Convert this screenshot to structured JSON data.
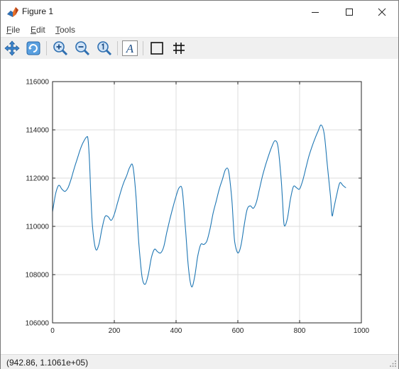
{
  "window": {
    "title": "Figure 1",
    "icon": "matlab-figure-icon",
    "controls": [
      "minimize-icon",
      "maximize-icon",
      "close-icon"
    ]
  },
  "menu": {
    "items": [
      {
        "label": "File",
        "mnemonic": "F",
        "rest": "ile"
      },
      {
        "label": "Edit",
        "mnemonic": "E",
        "rest": "dit"
      },
      {
        "label": "Tools",
        "mnemonic": "T",
        "rest": "ools"
      }
    ]
  },
  "toolbar": {
    "buttons": [
      "pan-icon",
      "rotate-icon",
      "zoom-in-icon",
      "zoom-out-icon",
      "zoom-reset-icon",
      "text-insert-icon",
      "axes-box-icon",
      "grid-icon"
    ]
  },
  "status": {
    "coordinates": "(942.86, 1.1061e+05)"
  },
  "chart_data": {
    "type": "line",
    "title": "",
    "xlabel": "",
    "ylabel": "",
    "xlim": [
      0,
      1000
    ],
    "ylim": [
      106000,
      116000
    ],
    "xticks": [
      "0",
      "200",
      "400",
      "600",
      "800",
      "1000"
    ],
    "yticks": [
      "106000",
      "108000",
      "110000",
      "112000",
      "114000",
      "116000"
    ],
    "grid": true,
    "series_color": "#1f77b4",
    "x": [
      0,
      10,
      20,
      30,
      40,
      50,
      60,
      70,
      80,
      90,
      100,
      110,
      115,
      120,
      125,
      130,
      140,
      150,
      160,
      170,
      180,
      190,
      200,
      210,
      220,
      230,
      240,
      250,
      260,
      270,
      275,
      280,
      290,
      300,
      310,
      320,
      330,
      340,
      350,
      360,
      370,
      380,
      390,
      400,
      410,
      420,
      430,
      440,
      450,
      460,
      470,
      480,
      490,
      500,
      510,
      520,
      530,
      540,
      550,
      560,
      570,
      580,
      585,
      590,
      600,
      610,
      620,
      630,
      640,
      650,
      660,
      670,
      680,
      690,
      700,
      710,
      720,
      730,
      740,
      745,
      750,
      760,
      770,
      780,
      790,
      800,
      810,
      820,
      830,
      840,
      850,
      860,
      870,
      880,
      890,
      900,
      905,
      910,
      920,
      930,
      940,
      950,
      960,
      970,
      980,
      990,
      1000
    ],
    "y": [
      110600,
      111350,
      111700,
      111550,
      111450,
      111600,
      111950,
      112400,
      112800,
      113200,
      113500,
      113700,
      113600,
      112600,
      111000,
      109900,
      109050,
      109250,
      109900,
      110400,
      110400,
      110250,
      110500,
      110950,
      111400,
      111800,
      112100,
      112450,
      112500,
      111300,
      110200,
      109200,
      107900,
      107600,
      108000,
      108700,
      109050,
      108950,
      108900,
      109150,
      109750,
      110300,
      110800,
      111250,
      111600,
      111500,
      110000,
      108300,
      107500,
      107900,
      108750,
      109250,
      109250,
      109400,
      109900,
      110550,
      111050,
      111550,
      111950,
      112350,
      112300,
      111200,
      110200,
      109350,
      108900,
      109200,
      110000,
      110700,
      110850,
      110750,
      111000,
      111550,
      112100,
      112550,
      112950,
      113300,
      113550,
      113300,
      112000,
      111000,
      110050,
      110300,
      111100,
      111650,
      111600,
      111550,
      111900,
      112400,
      112900,
      113300,
      113650,
      113950,
      114200,
      113800,
      112500,
      111250,
      110450,
      110700,
      111300,
      111800,
      111700,
      111600,
      111600
    ]
  }
}
